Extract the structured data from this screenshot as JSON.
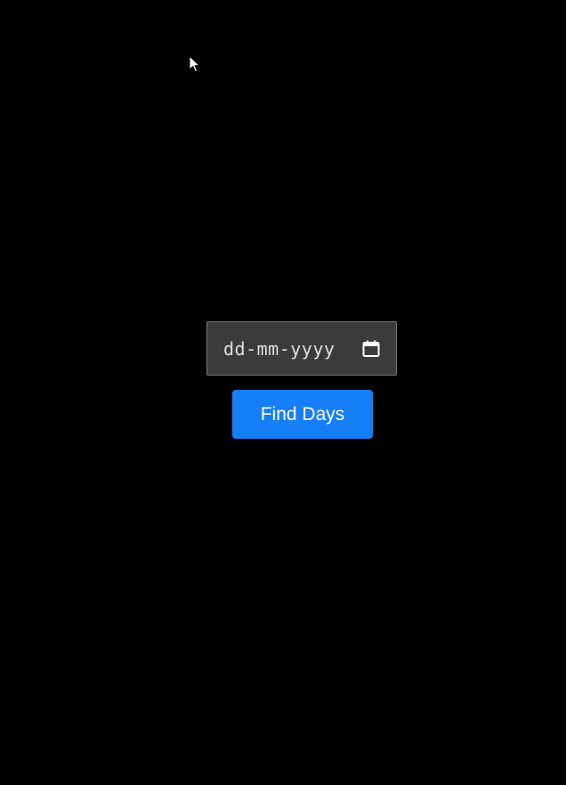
{
  "date_input": {
    "placeholder": "dd-mm-yyyy",
    "value": "",
    "icon": "calendar-icon"
  },
  "find_button": {
    "label": "Find Days",
    "color": "#167ff8"
  },
  "theme": {
    "background": "#000000",
    "input_background": "#3b3b3b",
    "input_border": "#7a7a7a"
  },
  "cursor": {
    "icon": "mouse-pointer-icon"
  }
}
